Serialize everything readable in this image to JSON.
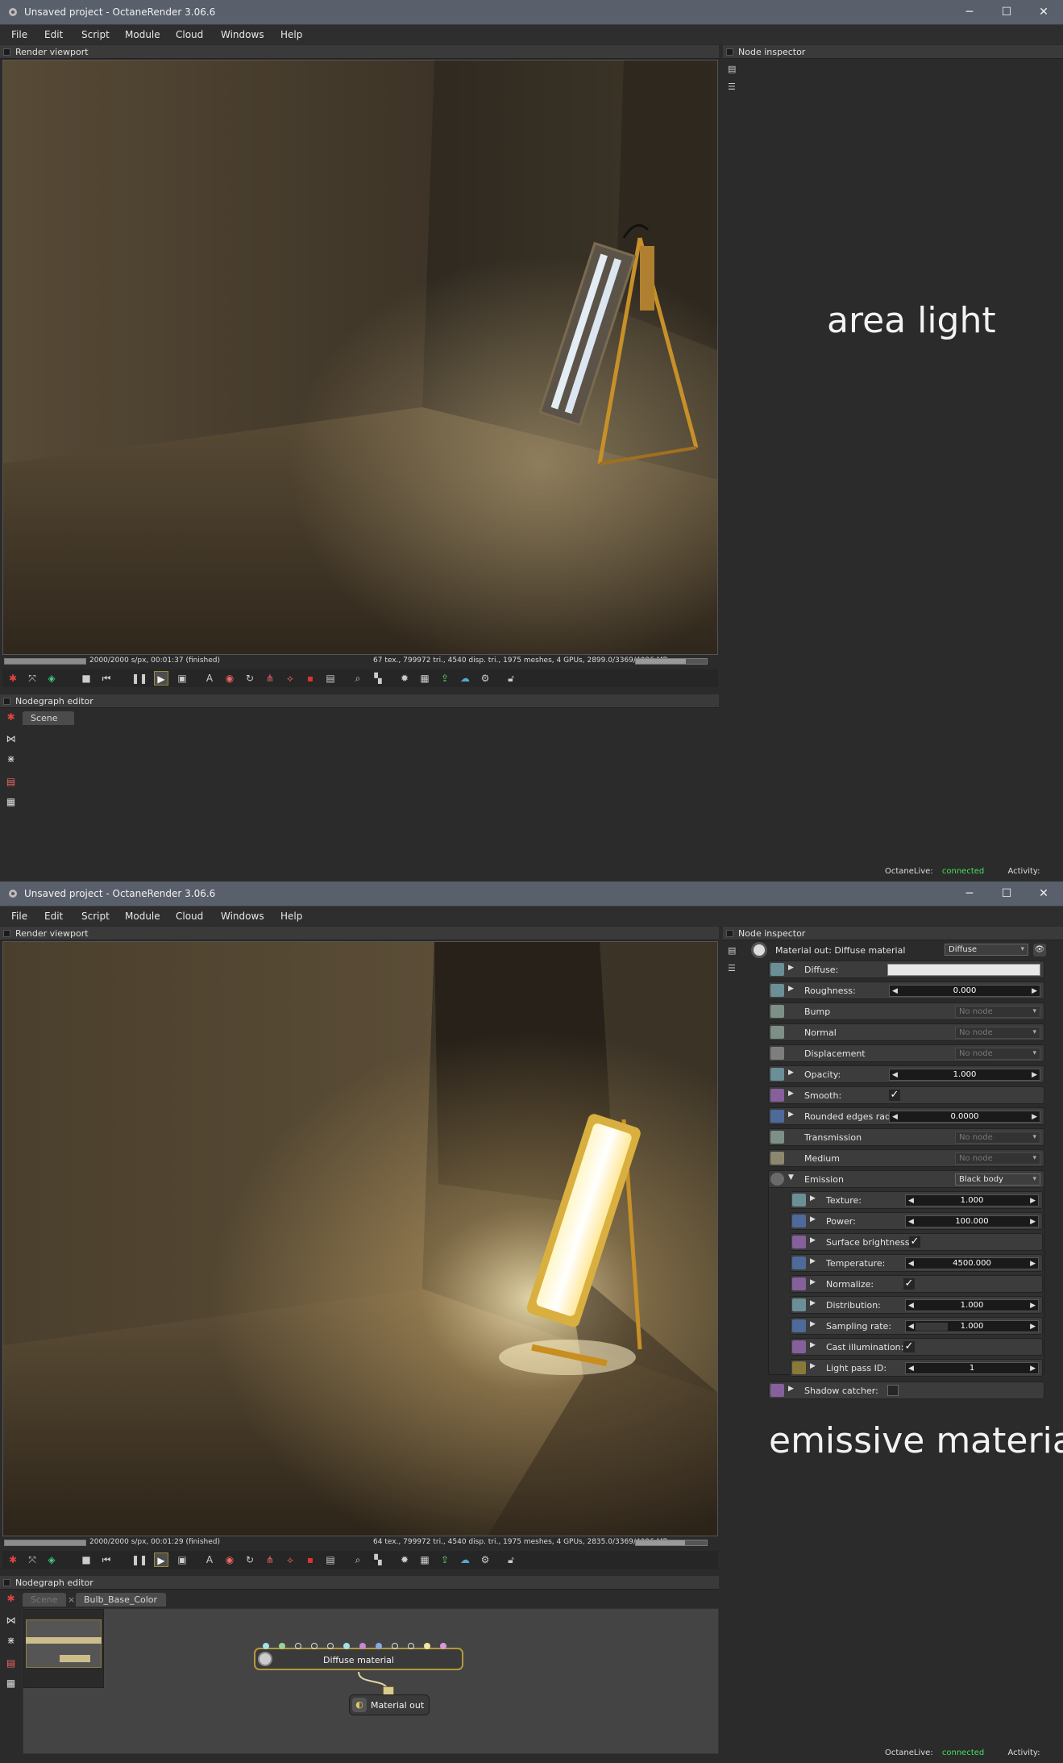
{
  "window_top": {
    "title": "Unsaved project - OctaneRender 3.06.6",
    "menu": [
      "File",
      "Edit",
      "Script",
      "Module",
      "Cloud",
      "Windows",
      "Help"
    ],
    "render_viewport_label": "Render viewport",
    "node_inspector_label": "Node inspector",
    "status_left": "2000/2000 s/px, 00:01:37 (finished)",
    "status_right": "67 tex., 799972 tri., 4540 disp. tri., 1975 meshes, 4 GPUs, 2899.0/3369/4096 MB",
    "render_progress": 1.0,
    "memory_progress": 0.71,
    "nodegraph_label": "Nodegraph editor",
    "tab_scene": "Scene",
    "caption": "area light",
    "octanelive_label": "OctaneLive:",
    "octanelive_status": "connected",
    "activity_label": "Activity:"
  },
  "window_bottom": {
    "title": "Unsaved project - OctaneRender 3.06.6",
    "menu": [
      "File",
      "Edit",
      "Script",
      "Module",
      "Cloud",
      "Windows",
      "Help"
    ],
    "render_viewport_label": "Render viewport",
    "node_inspector_label": "Node inspector",
    "status_left": "2000/2000 s/px, 00:01:29 (finished)",
    "status_right": "64 tex., 799972 tri., 4540 disp. tri., 1975 meshes, 4 GPUs, 2835.0/3369/4096 MB",
    "render_progress": 1.0,
    "memory_progress": 0.69,
    "nodegraph_label": "Nodegraph editor",
    "tab_scene": "Scene",
    "tab_close": "×",
    "tab_bulb": "Bulb_Base_Color",
    "node_diffuse": "Diffuse material",
    "node_matout": "Material out",
    "caption": "emissive material",
    "octanelive_label": "OctaneLive:",
    "octanelive_status": "connected",
    "activity_label": "Activity:",
    "inspector": {
      "material_title": "Material out: Diffuse material",
      "material_type": "Diffuse",
      "diffuse": "Diffuse:",
      "roughness": "Roughness:",
      "roughness_value": "0.000",
      "bump": "Bump",
      "normal": "Normal",
      "displacement": "Displacement",
      "no_node": "No node",
      "opacity": "Opacity:",
      "opacity_value": "1.000",
      "smooth": "Smooth:",
      "rounded_edges": "Rounded edges radius:",
      "rounded_value": "0.0000",
      "transmission": "Transmission",
      "medium": "Medium",
      "emission": "Emission",
      "emission_type": "Black body",
      "texture": "Texture:",
      "texture_value": "1.000",
      "power": "Power:",
      "power_value": "100.000",
      "surface_brightness": "Surface brightness:",
      "temperature": "Temperature:",
      "temperature_value": "4500.000",
      "normalize": "Normalize:",
      "distribution": "Distribution:",
      "distribution_value": "1.000",
      "sampling_rate": "Sampling rate:",
      "sampling_value": "1.000",
      "cast_illumination": "Cast illumination:",
      "light_pass_id": "Light pass ID:",
      "light_pass_value": "1",
      "shadow_catcher": "Shadow catcher:",
      "check": "✓"
    }
  },
  "colors": {
    "titlebar": "#59606b",
    "panel": "#2b2b2b",
    "connected": "#47e05a"
  }
}
